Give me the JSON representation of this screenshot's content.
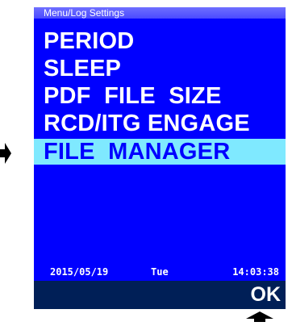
{
  "header": {
    "title": "Menu/Log Settings"
  },
  "menu": {
    "items": [
      {
        "label": "PERIOD"
      },
      {
        "label": "SLEEP"
      },
      {
        "label": "PDF  FILE  SIZE"
      },
      {
        "label": "RCD/ITG ENGAGE"
      },
      {
        "label": "FILE  MANAGER"
      }
    ],
    "selected_index": 4
  },
  "status": {
    "date": "2015/05/19",
    "day": "Tue",
    "time": "14:03:38"
  },
  "softkeys": {
    "ok_label": "OK"
  },
  "colors": {
    "screen_bg": "#0000ff",
    "highlight_bg": "#7fe9ff",
    "softkey_bar": "#001f57",
    "text": "#ffffff"
  },
  "icons": {
    "left_pointer": "arrow-right-icon",
    "up_pointer": "arrow-up-icon"
  }
}
